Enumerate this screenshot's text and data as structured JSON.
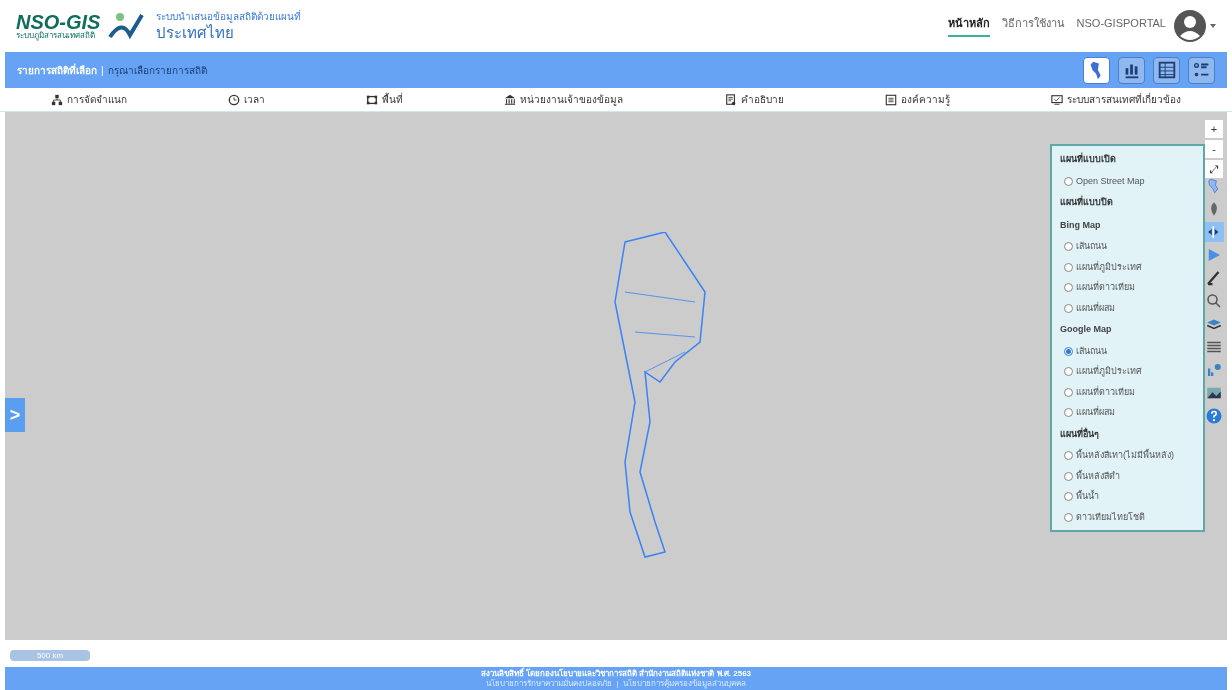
{
  "header": {
    "logo": "NSO-GIS",
    "logo_sub": "ระบบภูมิสารสนเทศสถิติ",
    "subtitle": "ระบบนำเสนอข้อมูลสถิติด้วยแผนที่",
    "title": "ประเทศไทย",
    "links": [
      {
        "label": "หน้าหลัก",
        "selected": true
      },
      {
        "label": "วิธีการใช้งาน",
        "selected": false
      },
      {
        "label": "NSO-GISPORTAL",
        "selected": false
      }
    ]
  },
  "selection_bar": {
    "label": "รายการสถิติที่เลือก",
    "separator": "|",
    "value": "กรุณาเลือกรายการสถิติ",
    "views": [
      {
        "kind": "map",
        "selected": true
      },
      {
        "kind": "chart",
        "selected": false
      },
      {
        "kind": "table",
        "selected": false
      },
      {
        "kind": "legend",
        "selected": false
      }
    ]
  },
  "menu": [
    {
      "kind": "hierarchy",
      "label": "การจัดจำแนก"
    },
    {
      "kind": "clock",
      "label": "เวลา"
    },
    {
      "kind": "area",
      "label": "พื้นที่"
    },
    {
      "kind": "bank",
      "label": "หน่วยงานเจ้าของข้อมูล"
    },
    {
      "kind": "doc",
      "label": "คำอธิบาย"
    },
    {
      "kind": "list",
      "label": "องค์ความรู้"
    },
    {
      "kind": "monitor",
      "label": "ระบบสารสนเทศที่เกี่ยวข้อง"
    }
  ],
  "map_controls": [
    {
      "label": "+"
    },
    {
      "label": "-"
    },
    {
      "label": "⤢"
    }
  ],
  "tools": [
    {
      "kind": "thailand",
      "selected": false
    },
    {
      "kind": "leaf",
      "selected": false
    },
    {
      "kind": "swipe",
      "selected": true
    },
    {
      "kind": "play",
      "selected": false
    },
    {
      "kind": "pen",
      "selected": false
    },
    {
      "kind": "search",
      "selected": false
    },
    {
      "kind": "layers",
      "selected": false
    },
    {
      "kind": "lines",
      "selected": false
    },
    {
      "kind": "stats",
      "selected": false
    },
    {
      "kind": "photo",
      "selected": false
    },
    {
      "kind": "help",
      "selected": false
    }
  ],
  "basemap_panel": [
    {
      "kind": "header",
      "label": "แผนที่แบบเปิด"
    },
    {
      "kind": "option",
      "label": "Open Street Map",
      "selected": false
    },
    {
      "kind": "header",
      "label": "แผนที่แบบปิด"
    },
    {
      "kind": "subheader",
      "label": "Bing Map"
    },
    {
      "kind": "option",
      "label": "เส้นถนน",
      "selected": false
    },
    {
      "kind": "option",
      "label": "แผนที่ภูมิประเทศ",
      "selected": false
    },
    {
      "kind": "option",
      "label": "แผนที่ดาวเทียม",
      "selected": false
    },
    {
      "kind": "option",
      "label": "แผนที่ผสม",
      "selected": false
    },
    {
      "kind": "subheader",
      "label": "Google Map"
    },
    {
      "kind": "option",
      "label": "เส้นถนน",
      "selected": true
    },
    {
      "kind": "option",
      "label": "แผนที่ภูมิประเทศ",
      "selected": false
    },
    {
      "kind": "option",
      "label": "แผนที่ดาวเทียม",
      "selected": false
    },
    {
      "kind": "option",
      "label": "แผนที่ผสม",
      "selected": false
    },
    {
      "kind": "header",
      "label": "แผนที่อื่นๆ"
    },
    {
      "kind": "option",
      "label": "พื้นหลังสีเทา(ไม่มีพื้นหลัง)",
      "selected": false
    },
    {
      "kind": "option",
      "label": "พื้นหลังสีดำ",
      "selected": false
    },
    {
      "kind": "option",
      "label": "พื้นน้ำ",
      "selected": false
    },
    {
      "kind": "option",
      "label": "ดาวเทียมไทยโชติ",
      "selected": false
    }
  ],
  "side_toggle": ">",
  "scale": "500 km",
  "footer": {
    "copyright": "สงวนลิขสิทธิ์ โดยกองนโยบายและวิชาการสถิติ สำนักงานสถิติแห่งชาติ พ.ศ. 2563",
    "links": [
      "นโยบายการรักษาความมั่นคงปลอดภัย",
      "นโยบายการคุ้มครองข้อมูลส่วนบุคคล"
    ],
    "separator": "|"
  }
}
